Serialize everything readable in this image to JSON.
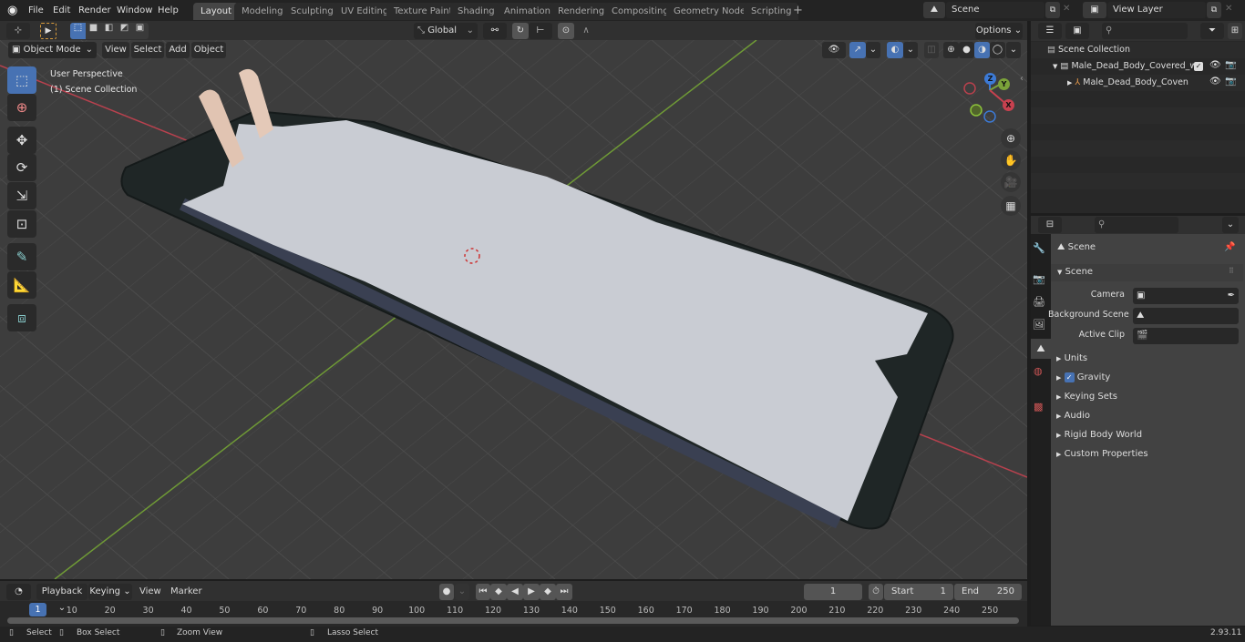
{
  "app": {
    "logo": "blender-logo-icon",
    "version": "2.93.11"
  },
  "menu": [
    "File",
    "Edit",
    "Render",
    "Window",
    "Help"
  ],
  "workspaces": [
    {
      "label": "Layout",
      "active": true
    },
    {
      "label": "Modeling"
    },
    {
      "label": "Sculpting"
    },
    {
      "label": "UV Editing"
    },
    {
      "label": "Texture Paint"
    },
    {
      "label": "Shading"
    },
    {
      "label": "Animation"
    },
    {
      "label": "Rendering"
    },
    {
      "label": "Compositing"
    },
    {
      "label": "Geometry Nodes"
    },
    {
      "label": "Scripting"
    }
  ],
  "add_workspace": "+",
  "scene_selector": {
    "value": "Scene"
  },
  "view_layer_selector": {
    "value": "View Layer"
  },
  "viewport_header": {
    "mode": "Object Mode",
    "menus": [
      "View",
      "Select",
      "Add",
      "Object"
    ],
    "transform_orientation": "Global",
    "options_label": "Options"
  },
  "viewport": {
    "overlay_line1": "User Perspective",
    "overlay_line2": "(1) Scene Collection",
    "gizmo_axes": {
      "x": "X",
      "y": "Y",
      "z": "Z"
    },
    "colors": {
      "x_axis": "#c8414f",
      "y_axis": "#7ba23a",
      "z_axis": "#3c7ad6",
      "grid": "#4d4d4d",
      "bg": "#3d3d3d"
    }
  },
  "tools": [
    "select-box",
    "cursor",
    "move",
    "rotate",
    "scale",
    "transform",
    "annotate",
    "measure",
    "add-cube"
  ],
  "outliner": {
    "root": "Scene Collection",
    "items": [
      {
        "label": "Male_Dead_Body_Covered_w",
        "type": "collection",
        "checked": true,
        "expanded": true
      },
      {
        "label": "Male_Dead_Body_Coven",
        "type": "armature",
        "expanded": false
      }
    ]
  },
  "properties": {
    "context_title": "Scene",
    "section": "Scene",
    "fields": [
      {
        "label": "Camera",
        "value": ""
      },
      {
        "label": "Background Scene",
        "value": ""
      },
      {
        "label": "Active Clip",
        "value": ""
      }
    ],
    "panels": [
      {
        "label": "Units"
      },
      {
        "label": "Gravity",
        "checkbox": true,
        "checked": true
      },
      {
        "label": "Keying Sets"
      },
      {
        "label": "Audio"
      },
      {
        "label": "Rigid Body World"
      },
      {
        "label": "Custom Properties"
      }
    ]
  },
  "timeline": {
    "menus": [
      "Playback",
      "Keying",
      "View",
      "Marker"
    ],
    "current_frame": "1",
    "start_label": "Start",
    "start": "1",
    "end_label": "End",
    "end": "250",
    "ticks": [
      "1",
      "10",
      "20",
      "30",
      "40",
      "50",
      "60",
      "70",
      "80",
      "90",
      "100",
      "110",
      "120",
      "130",
      "140",
      "150",
      "160",
      "170",
      "180",
      "190",
      "200",
      "210",
      "220",
      "230",
      "240",
      "250"
    ]
  },
  "statusbar": {
    "select": "Select",
    "box_select": "Box Select",
    "zoom_view": "Zoom View",
    "lasso_select": "Lasso Select"
  }
}
